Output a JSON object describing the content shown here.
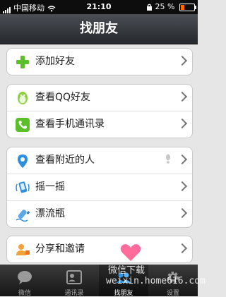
{
  "status_bar": {
    "carrier": "中国移动",
    "time": "21:10",
    "battery_percent": "25 %",
    "battery_level": 0.25
  },
  "nav": {
    "title": "找朋友"
  },
  "groups": [
    {
      "items": [
        {
          "label": "添加好友",
          "icon": "plus-icon"
        }
      ]
    },
    {
      "items": [
        {
          "label": "查看QQ好友",
          "icon": "qq-penguin-icon"
        },
        {
          "label": "查看手机通讯录",
          "icon": "phone-contacts-icon"
        }
      ]
    },
    {
      "items": [
        {
          "label": "查看附近的人",
          "icon": "location-pin-icon"
        },
        {
          "label": "摇一摇",
          "icon": "shake-icon"
        },
        {
          "label": "漂流瓶",
          "icon": "drift-bottle-icon"
        }
      ]
    },
    {
      "items": [
        {
          "label": "分享和邀请",
          "icon": "share-invite-icon"
        }
      ]
    }
  ],
  "tabs": [
    {
      "label": "微信",
      "icon": "chat-bubble-icon"
    },
    {
      "label": "通讯录",
      "icon": "contacts-card-icon"
    },
    {
      "label": "找朋友",
      "icon": "find-friends-icon",
      "active": true
    },
    {
      "label": "设置",
      "icon": "gear-icon"
    }
  ],
  "watermark": {
    "line1": "微信下载",
    "line2": "weixin.home616.com"
  },
  "colors": {
    "navbar": "#3a3d42",
    "accent_green": "#5bbf2a",
    "accent_blue": "#2d8fe0"
  }
}
